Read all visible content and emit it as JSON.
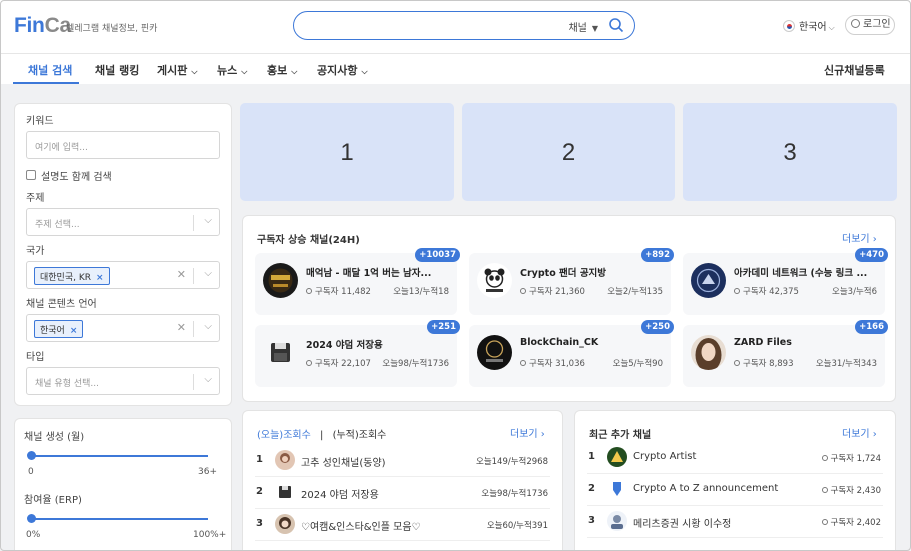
{
  "header": {
    "logo_main": "Fin",
    "logo_sub": "Ca",
    "tagline": "텔레그램 채널정보, 핀카",
    "search_scope": "채널",
    "language": "한국어",
    "login": "로그인"
  },
  "nav": {
    "items": [
      {
        "label": "채널 검색",
        "active": true
      },
      {
        "label": "채널 랭킹"
      },
      {
        "label": "게시판"
      },
      {
        "label": "뉴스"
      },
      {
        "label": "홍보"
      },
      {
        "label": "공지사항"
      }
    ],
    "register": "신규채널등록"
  },
  "filters": {
    "keyword_label": "키워드",
    "keyword_placeholder": "여기에 입력...",
    "desc_checkbox": "설명도 함께 검색",
    "topic_label": "주제",
    "topic_placeholder": "주제 선택...",
    "country_label": "국가",
    "country_tag": "대한민국, KR",
    "language_label": "채널 콘텐츠 언어",
    "language_tag": "한국어",
    "type_label": "타입",
    "type_placeholder": "채널 유형 선택...",
    "age_label": "채널 생성 (월)",
    "age_min": "0",
    "age_max": "36+",
    "erp_label": "참여율 (ERP)",
    "erp_min": "0%",
    "erp_max": "100%+"
  },
  "banners": [
    "1",
    "2",
    "3"
  ],
  "rising": {
    "title": "구독자 상승 채널(24H)",
    "more": "더보기",
    "cards": [
      {
        "name": "매억남 - 매달 1억 버는 남자...",
        "subs": "구독자 11,482",
        "today": "오늘13/누적18",
        "badge": "+10037"
      },
      {
        "name": "Crypto 팬더 공지방",
        "subs": "구독자 21,360",
        "today": "오늘2/누적135",
        "badge": "+892"
      },
      {
        "name": "아카데미 네트워크 (수능 링크 ...",
        "subs": "구독자 42,375",
        "today": "오늘3/누적6",
        "badge": "+470"
      },
      {
        "name": "2024 야덤 저장용",
        "subs": "구독자 22,107",
        "today": "오늘98/누적1736",
        "badge": "+251"
      },
      {
        "name": "BlockChain_CK",
        "subs": "구독자 31,036",
        "today": "오늘5/누적90",
        "badge": "+250"
      },
      {
        "name": "ZARD Files",
        "subs": "구독자 8,893",
        "today": "오늘31/누적343",
        "badge": "+166"
      }
    ]
  },
  "views": {
    "tab_today": "(오늘)조회수",
    "separator": "|",
    "tab_total": "(누적)조회수",
    "more": "더보기",
    "rows": [
      {
        "rank": "1",
        "name": "고추 성인채널(동양)",
        "value": "오늘149/누적2968"
      },
      {
        "rank": "2",
        "name": "2024 야덤 저장용",
        "value": "오늘98/누적1736"
      },
      {
        "rank": "3",
        "name": "♡여캠&인스타&인플 모음♡",
        "value": "오늘60/누적391"
      }
    ]
  },
  "recent": {
    "title": "최근 추가 채널",
    "more": "더보기",
    "rows": [
      {
        "rank": "1",
        "name": "Crypto Artist",
        "value": "구독자 1,724"
      },
      {
        "rank": "2",
        "name": "Crypto A to Z announcement",
        "value": "구독자 2,430"
      },
      {
        "rank": "3",
        "name": "메리츠증권 시황 이수정",
        "value": "구독자 2,402"
      }
    ]
  },
  "colors": {
    "accent": "#3d78d8",
    "banner": "#d9e3f8",
    "background": "#f0f1f3"
  }
}
